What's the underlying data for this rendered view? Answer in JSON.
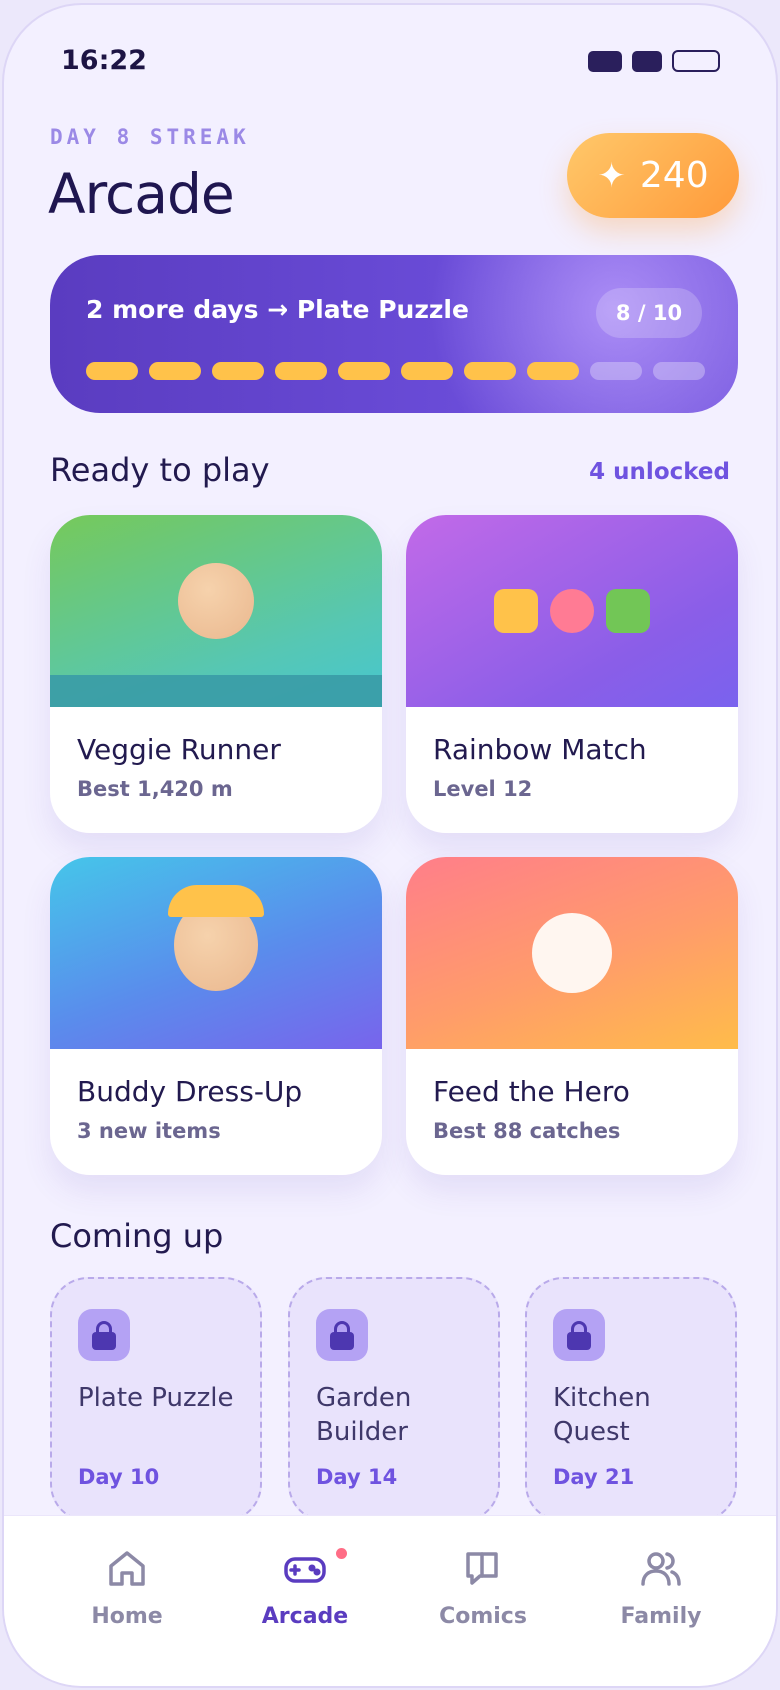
{
  "status_bar": {
    "time": "16:22"
  },
  "header": {
    "streak_label": "DAY 8 STREAK",
    "title": "Arcade",
    "points": "240",
    "points_icon": "sparkle-icon"
  },
  "streak_card": {
    "message": "2 more days → Plate Puzzle",
    "progress_text": "8 / 10",
    "progress_current": 8,
    "progress_total": 10
  },
  "ready": {
    "title": "Ready to play",
    "meta": "4 unlocked",
    "games": [
      {
        "name": "Veggie Runner",
        "sub": "Best 1,420 m"
      },
      {
        "name": "Rainbow Match",
        "sub": "Level 12"
      },
      {
        "name": "Buddy Dress-Up",
        "sub": "3 new items"
      },
      {
        "name": "Feed the Hero",
        "sub": "Best 88 catches"
      }
    ]
  },
  "coming_up": {
    "title": "Coming up",
    "items": [
      {
        "name": "Plate Puzzle",
        "day": "Day 10"
      },
      {
        "name": "Garden Builder",
        "day": "Day 14"
      },
      {
        "name": "Kitchen Quest",
        "day": "Day 21"
      }
    ]
  },
  "nav": {
    "items": [
      {
        "label": "Home",
        "icon": "home-icon"
      },
      {
        "label": "Arcade",
        "icon": "gamepad-icon",
        "active": true
      },
      {
        "label": "Comics",
        "icon": "book-icon"
      },
      {
        "label": "Family",
        "icon": "people-icon"
      }
    ]
  },
  "colors": {
    "primary": "#5a3cc0",
    "accent_orange": "#ff9a3a",
    "streak_yellow": "#ffc24a",
    "background": "#f3f0ff"
  }
}
